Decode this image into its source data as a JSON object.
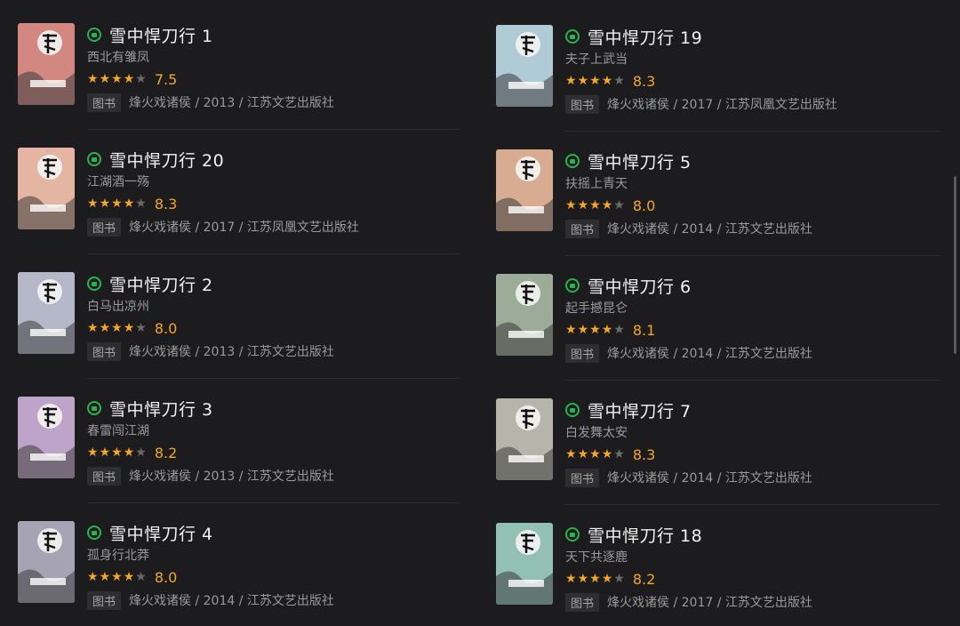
{
  "tag_label": "图书",
  "left": [
    {
      "title": "雪中悍刀行 1",
      "subtitle": "西北有雏凤",
      "stars": 4,
      "score": "7.5",
      "meta": "烽火戏诸侯 / 2013 / 江苏文艺出版社",
      "cover_color": "#c0392b"
    },
    {
      "title": "雪中悍刀行 20",
      "subtitle": "江湖酒一殇",
      "stars": 4,
      "score": "8.3",
      "meta": "烽火戏诸侯 / 2017 / 江苏凤凰文艺出版社",
      "cover_color": "#e08a6a"
    },
    {
      "title": "雪中悍刀行 2",
      "subtitle": "白马出凉州",
      "stars": 4,
      "score": "8.0",
      "meta": "烽火戏诸侯 / 2013 / 江苏文艺出版社",
      "cover_color": "#8a8fb0"
    },
    {
      "title": "雪中悍刀行 3",
      "subtitle": "春雷闯江湖",
      "stars": 4,
      "score": "8.2",
      "meta": "烽火戏诸侯 / 2013 / 江苏文艺出版社",
      "cover_color": "#9b6bb0"
    },
    {
      "title": "雪中悍刀行 4",
      "subtitle": "孤身行北莽",
      "stars": 4,
      "score": "8.0",
      "meta": "烽火戏诸侯 / 2014 / 江苏文艺出版社",
      "cover_color": "#6f6a8a"
    }
  ],
  "right": [
    {
      "title": "雪中悍刀行 19",
      "subtitle": "夫子上武当",
      "stars": 4,
      "score": "8.3",
      "meta": "烽火戏诸侯 / 2017 / 江苏凤凰文艺出版社",
      "cover_color": "#7fb3c9"
    },
    {
      "title": "雪中悍刀行 5",
      "subtitle": "扶摇上青天",
      "stars": 4,
      "score": "8.0",
      "meta": "烽火戏诸侯 / 2014 / 江苏文艺出版社",
      "cover_color": "#c97a4a"
    },
    {
      "title": "雪中悍刀行 6",
      "subtitle": "起手撼昆仑",
      "stars": 4,
      "score": "8.1",
      "meta": "烽火戏诸侯 / 2014 / 江苏文艺出版社",
      "cover_color": "#5f7a5a"
    },
    {
      "title": "雪中悍刀行 7",
      "subtitle": "白发舞太安",
      "stars": 4,
      "score": "8.3",
      "meta": "烽火戏诸侯 / 2014 / 江苏文艺出版社",
      "cover_color": "#8a8a7a"
    },
    {
      "title": "雪中悍刀行 18",
      "subtitle": "天下共逐鹿",
      "stars": 4,
      "score": "8.2",
      "meta": "烽火戏诸侯 / 2017 / 江苏文艺出版社",
      "cover_color": "#4aa08a"
    }
  ]
}
